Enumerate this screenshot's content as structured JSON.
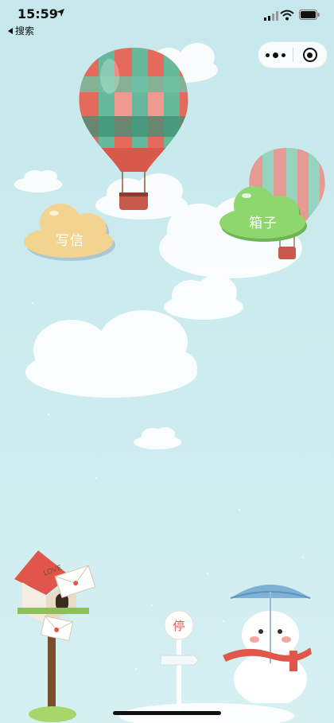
{
  "status_bar": {
    "time": "15:59",
    "back_label": "搜索"
  },
  "capsule": {
    "more_icon": "more-dots-icon",
    "close_icon": "target-circle-icon"
  },
  "actions": {
    "write_label": "写信",
    "box_label": "箱子"
  },
  "signpost": {
    "text": "停"
  },
  "mailbox": {
    "text": "LOVE"
  },
  "colors": {
    "sky": "#c9eaed",
    "write_cloud": "#f2d490",
    "box_cloud": "#8ed66e",
    "balloon_red": "#e86a5e",
    "balloon_green": "#5fb89a"
  }
}
